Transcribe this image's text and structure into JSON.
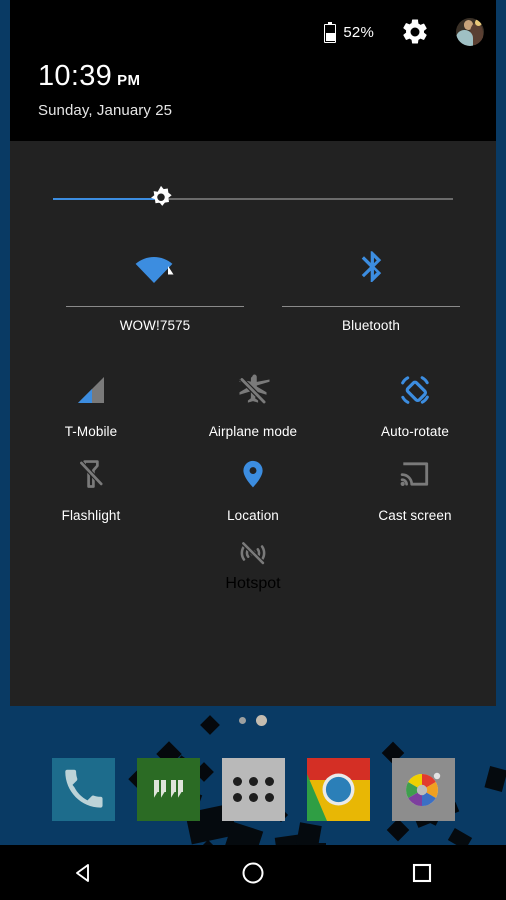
{
  "status_bar": {
    "battery_percent": "52%",
    "battery_icon": "battery-half-icon",
    "settings_icon": "gear-icon",
    "avatar_icon": "user-avatar"
  },
  "clock": {
    "time": "10:39",
    "meridiem": "PM",
    "date": "Sunday, January 25"
  },
  "brightness": {
    "label": "Brightness",
    "value_percent": 27,
    "thumb_icon": "brightness-sun-icon",
    "fill_color": "#3c8de0",
    "track_color": "#6b6b6b"
  },
  "quick_settings": {
    "duo_tiles": [
      {
        "name": "wifi",
        "label": "WOW!7575",
        "icon": "wifi-icon",
        "state": "on",
        "color": "#3c8de0"
      },
      {
        "name": "bluetooth",
        "label": "Bluetooth",
        "icon": "bluetooth-icon",
        "state": "on",
        "color": "#3c8de0"
      }
    ],
    "tiles": [
      {
        "name": "cellular",
        "label": "T-Mobile",
        "icon": "signal-bars-icon",
        "state": "on",
        "color": "#3c8de0"
      },
      {
        "name": "airplane-mode",
        "label": "Airplane mode",
        "icon": "airplane-off-icon",
        "state": "off",
        "color": "#7a7a7a"
      },
      {
        "name": "auto-rotate",
        "label": "Auto-rotate",
        "icon": "auto-rotate-icon",
        "state": "on",
        "color": "#3c8de0"
      },
      {
        "name": "flashlight",
        "label": "Flashlight",
        "icon": "flashlight-off-icon",
        "state": "off",
        "color": "#7a7a7a"
      },
      {
        "name": "location",
        "label": "Location",
        "icon": "location-pin-icon",
        "state": "on",
        "color": "#3c8de0"
      },
      {
        "name": "cast-screen",
        "label": "Cast screen",
        "icon": "cast-screen-icon",
        "state": "off",
        "color": "#7a7a7a"
      },
      {
        "name": "hotspot",
        "label": "Hotspot",
        "icon": "hotspot-off-icon",
        "state": "off",
        "color": "#7a7a7a"
      }
    ]
  },
  "home": {
    "page_dots": {
      "count": 2,
      "active_index": 1
    },
    "dock": [
      {
        "name": "phone",
        "label": "Phone",
        "icon": "phone-icon",
        "color": "#1d6c8c"
      },
      {
        "name": "hangouts",
        "label": "Hangouts",
        "icon": "hangouts-icon",
        "color": "#2b6b24"
      },
      {
        "name": "app-drawer",
        "label": "Apps",
        "icon": "app-drawer-icon",
        "color": "#b9b9b9"
      },
      {
        "name": "chrome",
        "label": "Chrome",
        "icon": "chrome-icon",
        "color": "#f0b400"
      },
      {
        "name": "photos",
        "label": "Photos",
        "icon": "photos-icon",
        "color": "#8d8d8d"
      }
    ]
  },
  "navigation_bar": [
    {
      "name": "back",
      "label": "Back",
      "icon": "back-triangle-icon"
    },
    {
      "name": "home",
      "label": "Home",
      "icon": "home-circle-icon"
    },
    {
      "name": "recents",
      "label": "Recents",
      "icon": "recents-square-icon"
    }
  ],
  "colors": {
    "panel_bg": "#222222",
    "header_bg": "#000000",
    "accent": "#3c8de0",
    "inactive": "#7a7a7a",
    "wallpaper": "#093a64"
  }
}
